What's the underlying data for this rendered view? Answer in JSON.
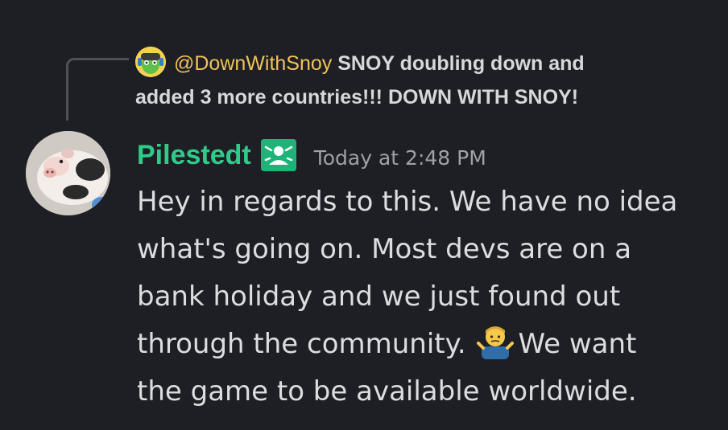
{
  "reply": {
    "author": "@DownWithSnoy",
    "text_line1": "SNOY doubling down and",
    "text_line2": "added 3 more countries!!! DOWN WITH SNOY!"
  },
  "message": {
    "author": "Pilestedt",
    "timestamp": "Today at 2:48 PM",
    "lines": [
      "Hey in regards to this. We have no idea",
      "what's going on. Most devs are on a",
      "bank holiday and we just found out",
      "through the community.",
      "We want",
      "the game to be available worldwide."
    ],
    "emoji": "man-shrugging-emoji"
  },
  "colors": {
    "background": "#1e1f24",
    "username": "#2ecc88",
    "reply_author": "#f0c15a",
    "message_text": "#dcdde1",
    "timestamp": "#9ea1a8"
  }
}
